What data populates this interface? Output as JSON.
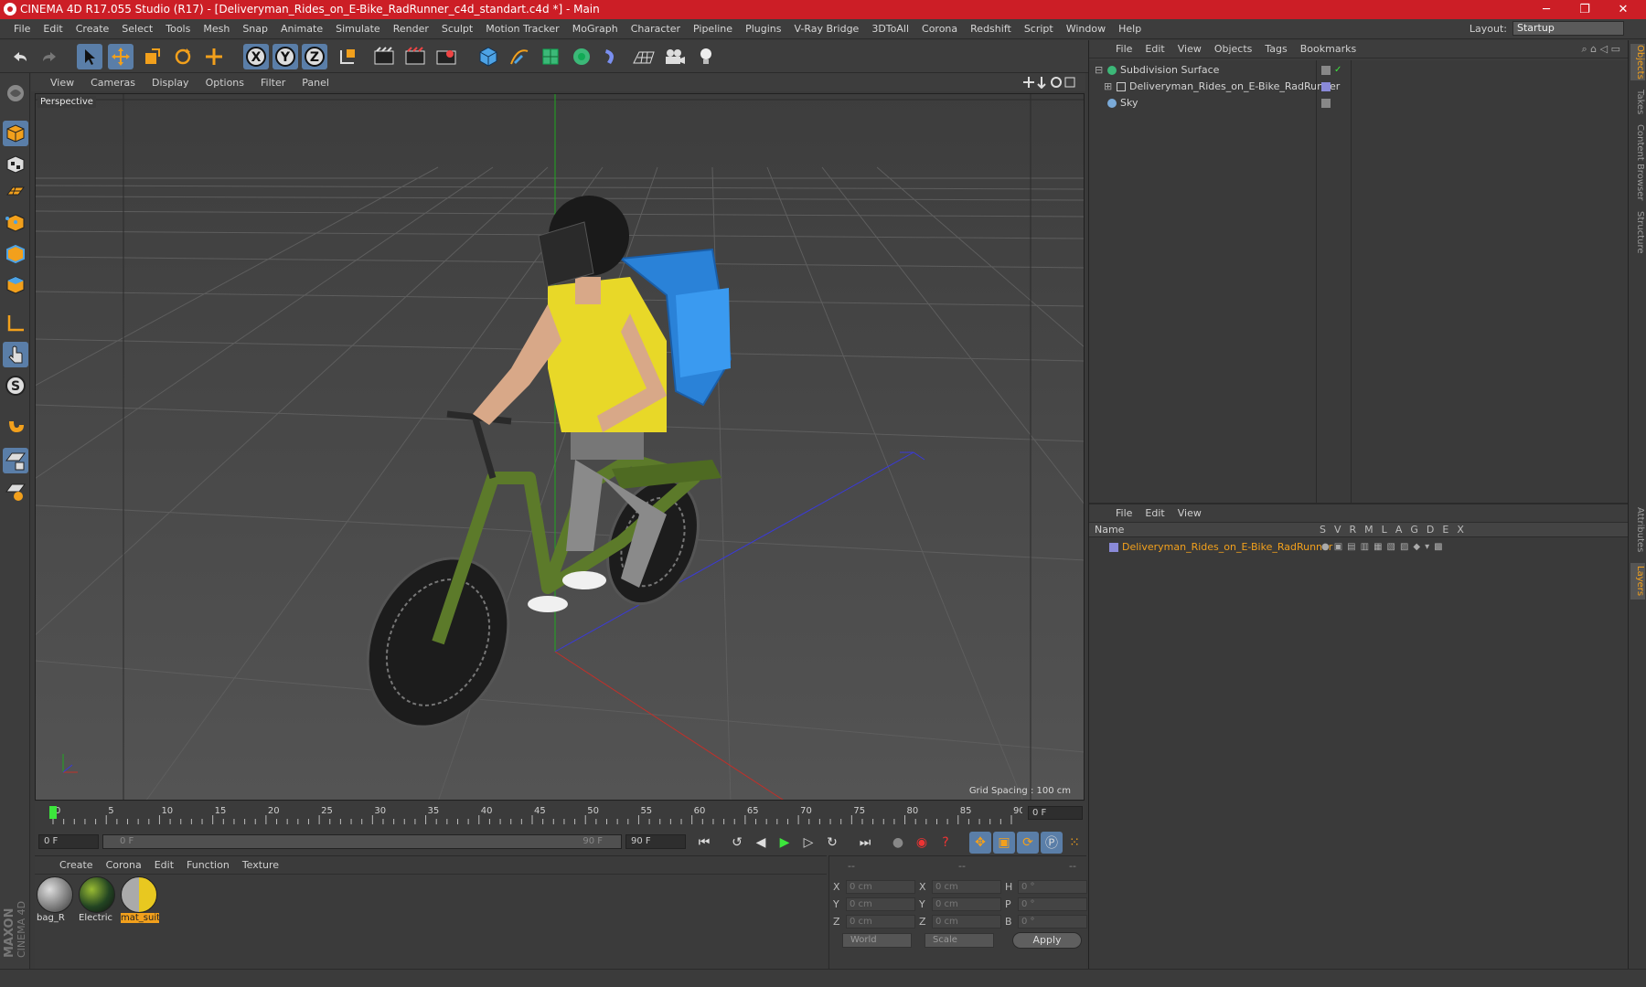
{
  "window": {
    "title": "CINEMA 4D R17.055 Studio (R17) - [Deliveryman_Rides_on_E-Bike_RadRunner_c4d_standart.c4d *] - Main",
    "min": "─",
    "max": "❐",
    "close": "✕"
  },
  "menu": [
    "File",
    "Edit",
    "Create",
    "Select",
    "Tools",
    "Mesh",
    "Snap",
    "Animate",
    "Simulate",
    "Render",
    "Sculpt",
    "Motion Tracker",
    "MoGraph",
    "Character",
    "Pipeline",
    "Plugins",
    "V-Ray Bridge",
    "3DToAll",
    "Corona",
    "Redshift",
    "Script",
    "Window",
    "Help"
  ],
  "layout": {
    "label": "Layout:",
    "value": "Startup"
  },
  "axis_buttons": {
    "x": "X",
    "y": "Y",
    "z": "Z"
  },
  "viewport": {
    "menu": [
      "View",
      "Cameras",
      "Display",
      "Options",
      "Filter",
      "Panel"
    ],
    "label": "Perspective",
    "grid_spacing": "Grid Spacing : 100 cm"
  },
  "timeline": {
    "ticks": [
      "0",
      "5",
      "10",
      "15",
      "20",
      "25",
      "30",
      "35",
      "40",
      "45",
      "50",
      "55",
      "60",
      "65",
      "70",
      "75",
      "80",
      "85",
      "90"
    ],
    "current_frame": "0 F"
  },
  "transport": {
    "start": "0 F",
    "range_start": "0 F",
    "range_end": "90 F",
    "end": "90 F"
  },
  "materials": {
    "menu": [
      "Create",
      "Corona",
      "Edit",
      "Function",
      "Texture"
    ],
    "items": [
      {
        "label": "bag_R"
      },
      {
        "label": "Electric"
      },
      {
        "label": "mat_suit"
      }
    ]
  },
  "coords": {
    "header": [
      "--",
      "--",
      "--"
    ],
    "rows": [
      {
        "a": "X",
        "av": "0 cm",
        "b": "X",
        "bv": "0 cm",
        "c": "H",
        "cv": "0 °"
      },
      {
        "a": "Y",
        "av": "0 cm",
        "b": "Y",
        "bv": "0 cm",
        "c": "P",
        "cv": "0 °"
      },
      {
        "a": "Z",
        "av": "0 cm",
        "b": "Z",
        "bv": "0 cm",
        "c": "B",
        "cv": "0 °"
      }
    ],
    "world": "World",
    "scale": "Scale",
    "apply": "Apply"
  },
  "objects_panel": {
    "menu": [
      "File",
      "Edit",
      "View",
      "Objects",
      "Tags",
      "Bookmarks"
    ],
    "items": [
      {
        "name": "Subdivision Surface"
      },
      {
        "name": "Deliveryman_Rides_on_E-Bike_RadRunner"
      },
      {
        "name": "Sky"
      }
    ]
  },
  "layers_panel": {
    "menu": [
      "File",
      "Edit",
      "View"
    ],
    "name_header": "Name",
    "cols": [
      "S",
      "V",
      "R",
      "M",
      "L",
      "A",
      "G",
      "D",
      "E",
      "X"
    ],
    "item": "Deliveryman_Rides_on_E-Bike_RadRunner"
  },
  "right_tabs": [
    "Objects",
    "Takes",
    "Content Browser",
    "Structure",
    "Attributes",
    "Layers"
  ],
  "maxon": {
    "line1": "MAXON",
    "line2": "CINEMA 4D"
  },
  "colors": {
    "accent": "#f2a01c",
    "selected_tool": "#5a7ea8",
    "title": "#cc1e26"
  }
}
